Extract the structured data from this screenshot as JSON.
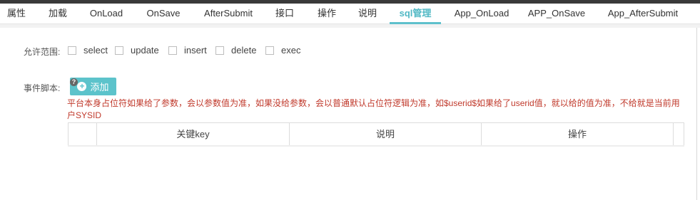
{
  "tabs": [
    {
      "label": "属性"
    },
    {
      "label": "加载"
    },
    {
      "label": "OnLoad"
    },
    {
      "label": "OnSave"
    },
    {
      "label": "AfterSubmit"
    },
    {
      "label": "接口"
    },
    {
      "label": "操作"
    },
    {
      "label": "说明"
    },
    {
      "label": "sql管理",
      "active": true
    },
    {
      "label": "App_OnLoad"
    },
    {
      "label": "APP_OnSave"
    },
    {
      "label": "App_AfterSubmit"
    }
  ],
  "scope": {
    "label": "允许范围:",
    "options": [
      {
        "label": "select",
        "checked": false
      },
      {
        "label": "update",
        "checked": false
      },
      {
        "label": "insert",
        "checked": false
      },
      {
        "label": "delete",
        "checked": false
      },
      {
        "label": "exec",
        "checked": false
      }
    ]
  },
  "script": {
    "label": "事件脚本:",
    "add_label": "添加",
    "help_icon": "?",
    "note": "平台本身占位符如果给了参数，会以参数值为准，如果没给参数，会以普通默认占位符逻辑为准，如$userid$如果给了userid值，就以给的值为准，不给就是当前用户SYSID"
  },
  "table": {
    "columns": [
      "关键key",
      "说明",
      "操作"
    ]
  },
  "colors": {
    "accent": "#5ec0cc",
    "note": "#c0392b"
  }
}
